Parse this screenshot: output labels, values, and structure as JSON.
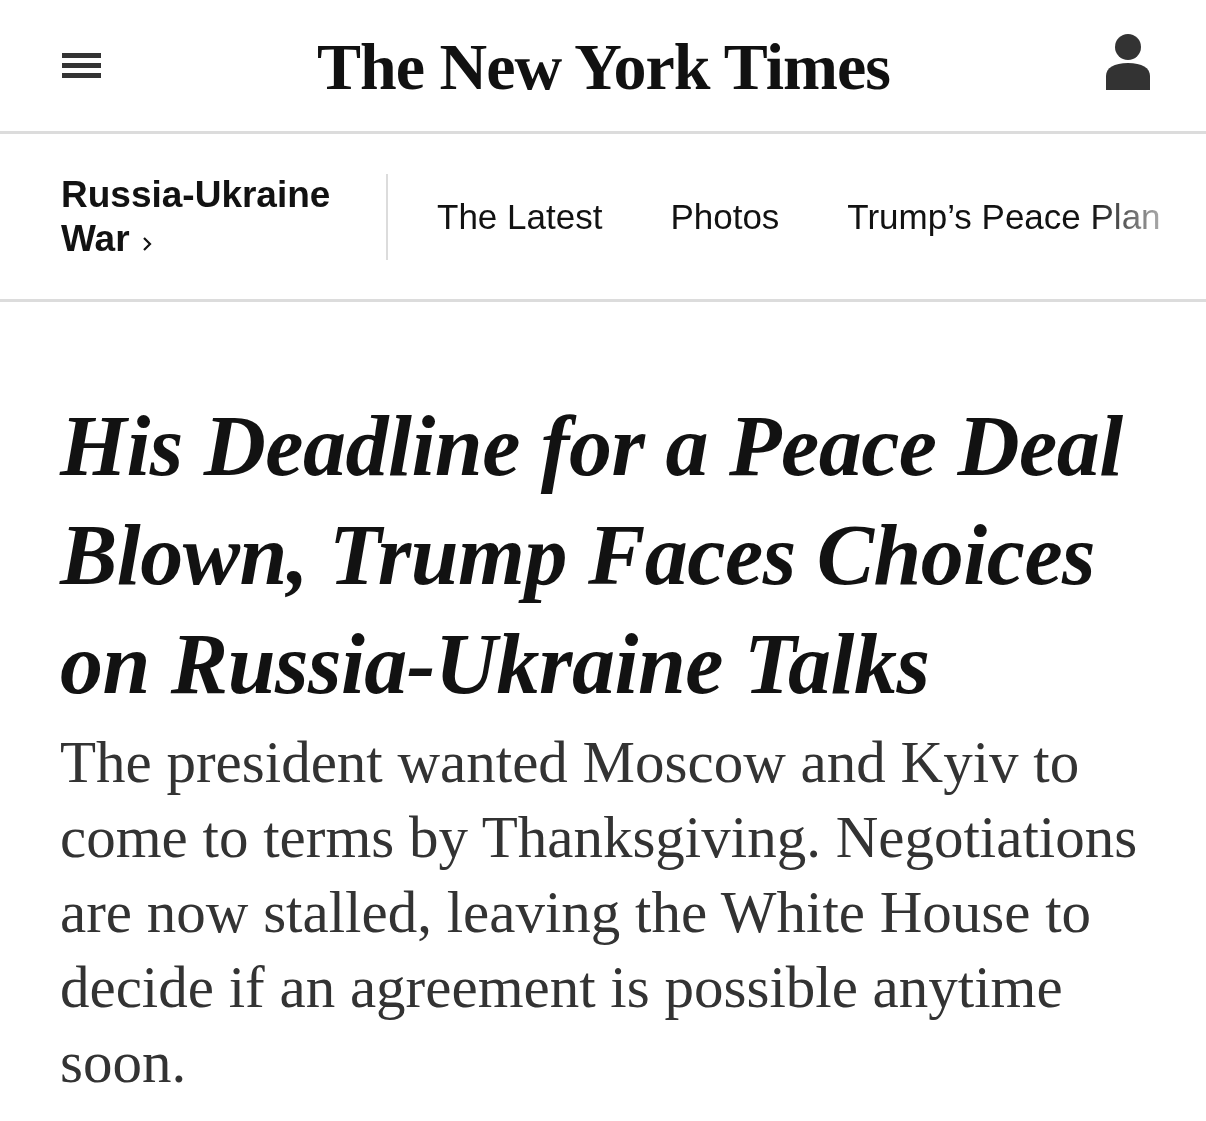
{
  "header": {
    "logo": "The New York Times"
  },
  "section_nav": {
    "section": "Russia-Ukraine War",
    "links": [
      "The Latest",
      "Photos",
      "Trump’s Peace Plan"
    ]
  },
  "article": {
    "headline": "His Deadline for a Peace Deal Blown, Trump Faces Choices on Russia-Ukraine Talks",
    "summary": "The president wanted Moscow and Kyiv to come to terms by Thanksgiving. Negotiations are now stalled, leaving the White House to decide if an agreement is possible anytime soon."
  }
}
